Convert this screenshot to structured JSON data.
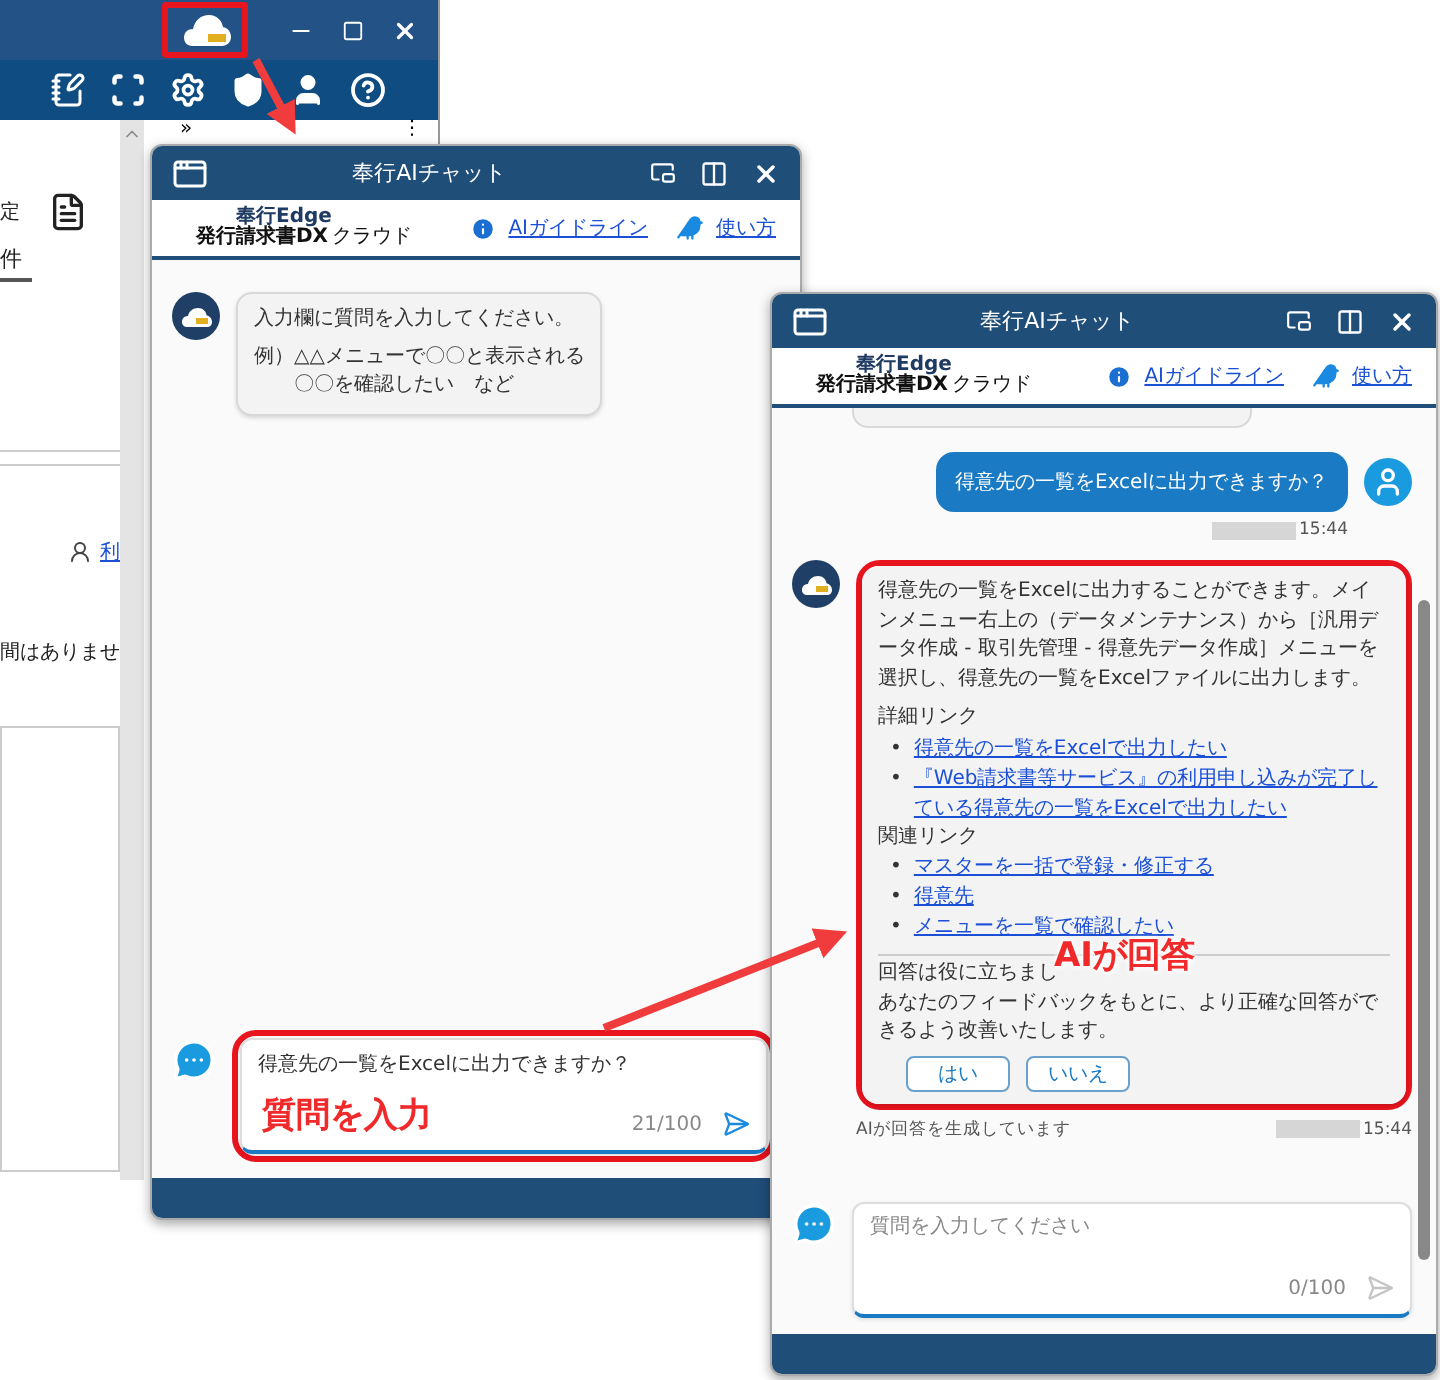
{
  "background_app": {
    "ai_button_highlighted": true,
    "expand_glyph": "»",
    "menu_glyph": "⋮",
    "setting_label": "定",
    "tab": {
      "label": "件",
      "selected": true
    },
    "user_link": "利",
    "message_fragment": "間はありませ"
  },
  "chat_windows": [
    {
      "title": "奉行AIチャット",
      "logo": {
        "top": "奉行Edge",
        "main": "発行請求書DX",
        "sub": "クラウド"
      },
      "guideline_link": "AIガイドライン",
      "howto_link": "使い方",
      "messages": [
        {
          "kind": "ai",
          "intro": "入力欄に質問を入力してください。",
          "example_label": "例）",
          "example_lines": [
            "△△メニューで〇〇と表示される",
            "〇〇を確認したい　など"
          ]
        }
      ],
      "input": {
        "value": "得意先の一覧をExcelに出力できますか？",
        "counter": "21/100",
        "send_enabled": true,
        "callout": "質問を入力"
      }
    },
    {
      "title": "奉行AIチャット",
      "logo": {
        "top": "奉行Edge",
        "main": "発行請求書DX",
        "sub": "クラウド"
      },
      "guideline_link": "AIガイドライン",
      "howto_link": "使い方",
      "messages": [
        {
          "kind": "clipped"
        },
        {
          "kind": "user",
          "text": "得意先の一覧をExcelに出力できますか？",
          "time": "15:44"
        },
        {
          "kind": "answer",
          "callout": "AIが回答",
          "paragraph": "得意先の一覧をExcelに出力することができます。メインメニュー右上の（データメンテナンス）から［汎用データ作成 - 取引先管理 - 得意先データ作成］メニューを選択し、得意先の一覧をExcelファイルに出力します。",
          "sections": [
            {
              "heading": "詳細リンク",
              "bullet": "•",
              "links": [
                "得意先の一覧をExcelで出力したい",
                "『Web請求書等サービス』の利用申し込みが完了している得意先の一覧をExcelで出力したい"
              ]
            },
            {
              "heading": "関連リンク",
              "bullet": "•",
              "links": [
                "マスターを一括で登録・修正する",
                "得意先",
                "メニューを一覧で確認したい"
              ]
            }
          ],
          "feedback": {
            "question": "回答は役に立ちまし",
            "note": "あなたのフィードバックをもとに、より正確な回答ができるよう改善いたします。",
            "buttons": [
              "はい",
              "いいえ"
            ]
          },
          "status": "AIが回答を生成しています",
          "time": "15:44"
        }
      ],
      "input": {
        "placeholder": "質問を入力してください",
        "counter": "0/100",
        "send_enabled": false
      }
    }
  ]
}
